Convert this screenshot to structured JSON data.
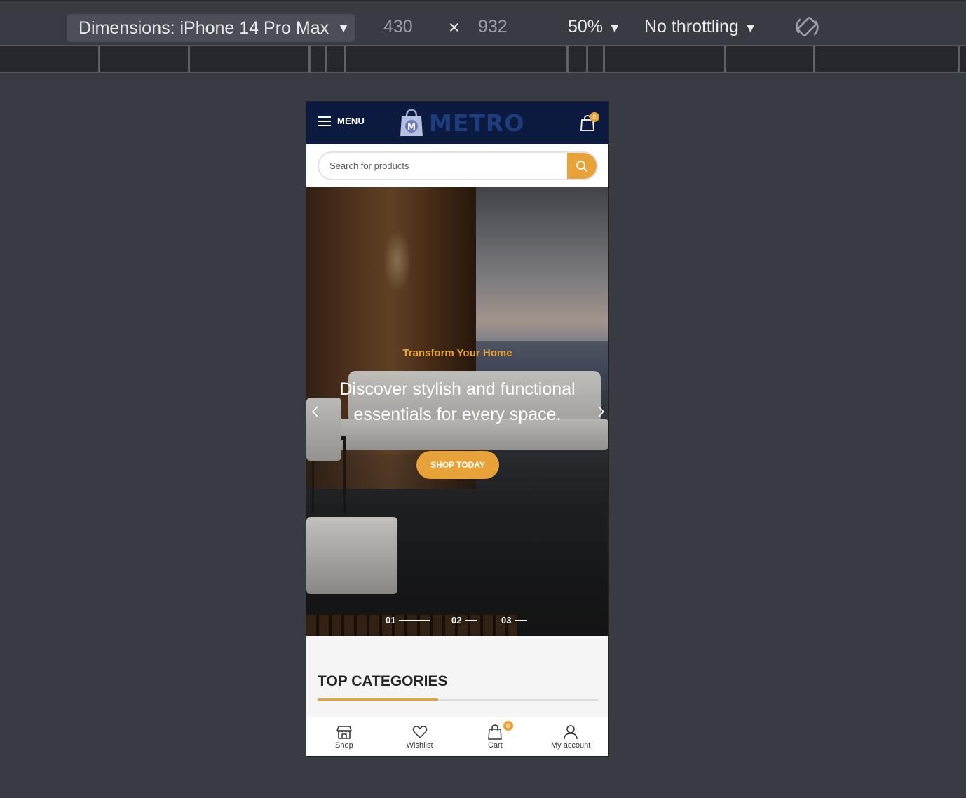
{
  "devtools": {
    "device_label": "Dimensions: iPhone 14 Pro Max",
    "width": "430",
    "times": "×",
    "height": "932",
    "zoom": "50%",
    "throttling": "No throttling"
  },
  "header": {
    "menu_label": "MENU",
    "logo_text": "METRO",
    "logo_letter": "M",
    "cart_count": "0"
  },
  "search": {
    "placeholder": "Search for products"
  },
  "hero": {
    "subtitle": "Transform Your Home",
    "title": "Discover stylish and functional essentials for every space.",
    "button_label": "SHOP TODAY",
    "pager": [
      {
        "label": "01"
      },
      {
        "label": "02"
      },
      {
        "label": "03"
      }
    ]
  },
  "section": {
    "title": "TOP CATEGORIES"
  },
  "bottom_nav": {
    "items": [
      {
        "label": "Shop",
        "icon": "shop-icon"
      },
      {
        "label": "Wishlist",
        "icon": "heart-icon"
      },
      {
        "label": "Cart",
        "icon": "cart-icon"
      },
      {
        "label": "My account",
        "icon": "user-icon"
      }
    ],
    "cart_count": "0"
  },
  "colors": {
    "accent": "#e8a23a",
    "header_bg": "#0c1a3f",
    "logo": "#1d3d7c",
    "devtools_bg": "#393b43"
  }
}
